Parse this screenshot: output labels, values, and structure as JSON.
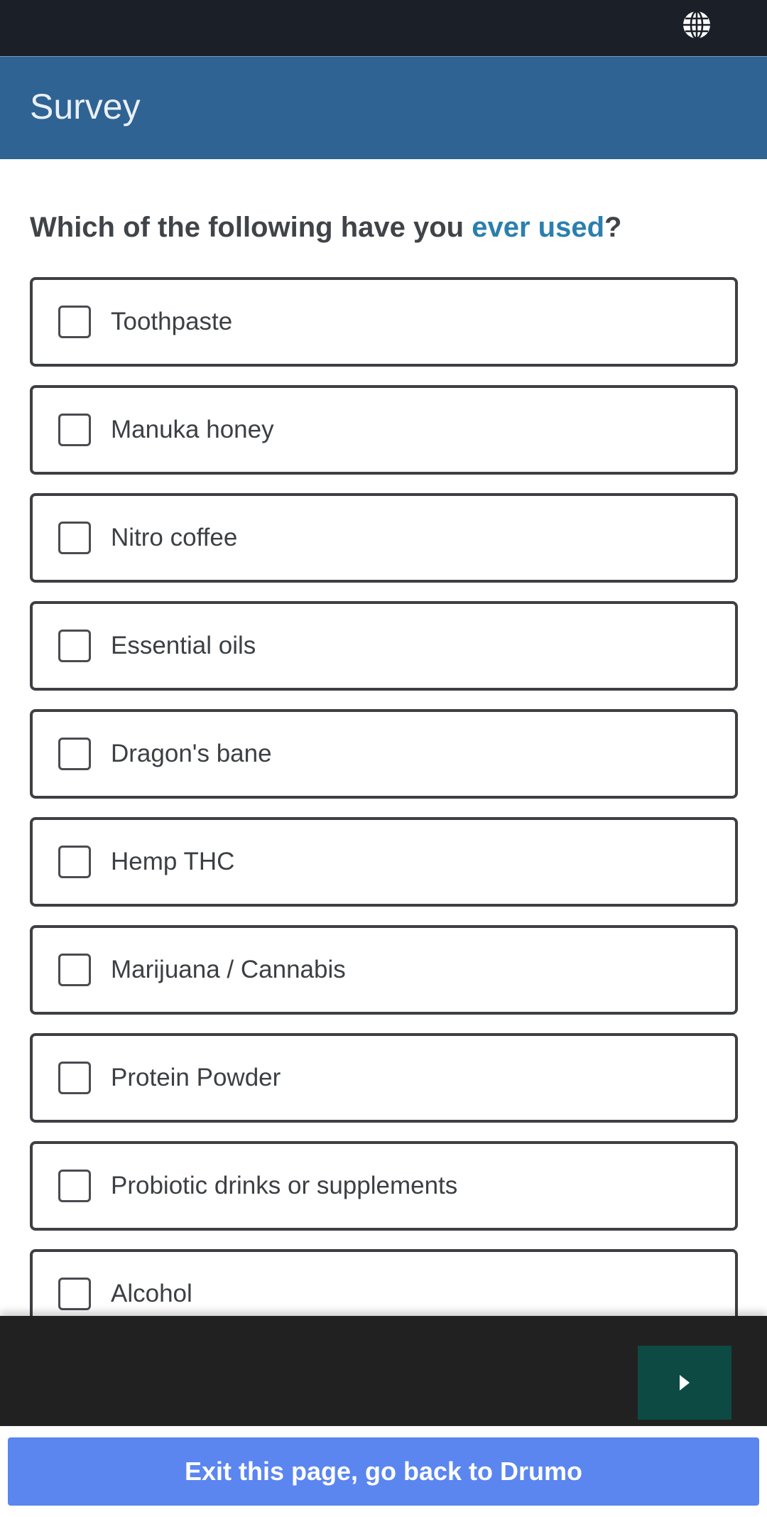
{
  "status_bar": {
    "icon": "globe-icon"
  },
  "header": {
    "title": "Survey"
  },
  "question": {
    "prefix": "Which of the following have you ",
    "highlight": "ever used",
    "suffix": "?",
    "highlight_color": "#2b7fae"
  },
  "options": [
    {
      "label": "Toothpaste",
      "checked": false
    },
    {
      "label": "Manuka honey",
      "checked": false
    },
    {
      "label": "Nitro coffee",
      "checked": false
    },
    {
      "label": "Essential oils",
      "checked": false
    },
    {
      "label": "Dragon's bane",
      "checked": false
    },
    {
      "label": "Hemp THC",
      "checked": false
    },
    {
      "label": "Marijuana / Cannabis",
      "checked": false
    },
    {
      "label": "Protein Powder",
      "checked": false
    },
    {
      "label": "Probiotic drinks or supplements",
      "checked": false
    },
    {
      "label": "Alcohol",
      "checked": false
    }
  ],
  "footer": {
    "next_icon": "play-triangle-icon",
    "next_color": "#0d4a44"
  },
  "exit_button": {
    "label": "Exit this page, go back to Drumo",
    "color": "#5b86f0"
  },
  "colors": {
    "header_bg": "#2f6393",
    "status_bar_bg": "#1b1f27",
    "footer_bg": "#212121"
  }
}
